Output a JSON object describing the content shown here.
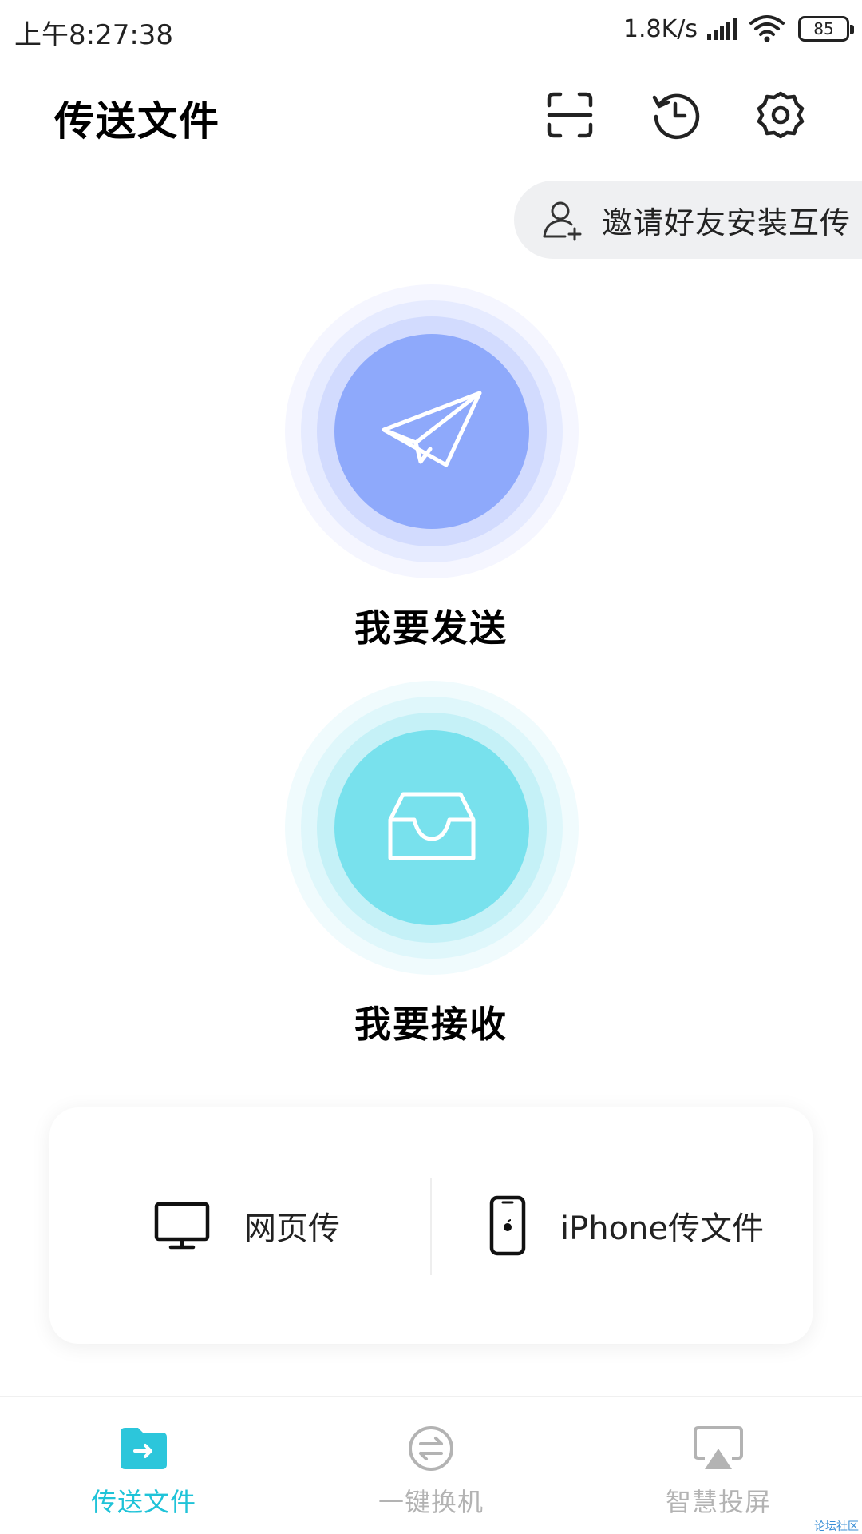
{
  "status_bar": {
    "time": "上午8:27:38",
    "net_speed": "1.8K/s",
    "battery": "85"
  },
  "header": {
    "title": "传送文件"
  },
  "invite": {
    "label": "邀请好友安装互传"
  },
  "send": {
    "label": "我要发送"
  },
  "receive": {
    "label": "我要接收"
  },
  "card": {
    "web_label": "网页传",
    "iphone_label": "iPhone传文件"
  },
  "bottom_nav": {
    "items": [
      {
        "label": "传送文件",
        "icon": "folder-arrow-icon",
        "active": true
      },
      {
        "label": "一键换机",
        "icon": "swap-icon",
        "active": false
      },
      {
        "label": "智慧投屏",
        "icon": "screen-cast-icon",
        "active": false
      }
    ]
  },
  "watermark": "论坛社区",
  "colors": {
    "accent": "#1fc3d8",
    "send_core": "#8ea9fb",
    "receive_core": "#78e1ed"
  }
}
